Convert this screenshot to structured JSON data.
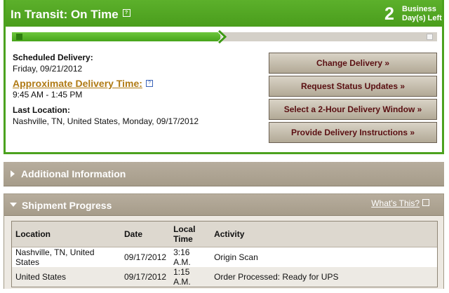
{
  "transit": {
    "title": "In Transit: On Time",
    "days_count": "2",
    "days_label_line1": "Business",
    "days_label_line2": "Day(s) Left",
    "progress_fraction": 0.49
  },
  "details": {
    "scheduled_label": "Scheduled Delivery:",
    "scheduled_value": "Friday, 09/21/2012",
    "approx_label": "Approximate Delivery Time:",
    "approx_value": "9:45 AM - 1:45 PM",
    "last_location_label": "Last Location:",
    "last_location_value": "Nashville, TN, United States, Monday, 09/17/2012"
  },
  "actions": [
    {
      "label": "Change Delivery »"
    },
    {
      "label": "Request Status Updates »"
    },
    {
      "label": "Select a 2-Hour Delivery Window »"
    },
    {
      "label": "Provide Delivery Instructions »"
    }
  ],
  "additional": {
    "title": "Additional Information"
  },
  "shipment": {
    "title": "Shipment Progress",
    "whats_this": "What's This?",
    "columns": {
      "location": "Location",
      "date": "Date",
      "time_line1": "Local",
      "time_line2": "Time",
      "activity": "Activity"
    },
    "rows": [
      {
        "location": "Nashville, TN, United States",
        "date": "09/17/2012",
        "time": "3:16 A.M.",
        "activity": "Origin Scan"
      },
      {
        "location": "United States",
        "date": "09/17/2012",
        "time": "1:15 A.M.",
        "activity": "Order Processed: Ready for UPS"
      }
    ]
  },
  "colors": {
    "green": "#4ca21f",
    "tan": "#ab a18f",
    "button_text": "#5a0f12",
    "approx_label": "#b07a14"
  }
}
